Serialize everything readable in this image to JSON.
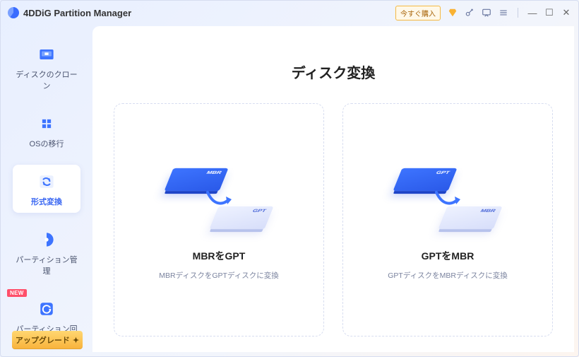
{
  "app": {
    "title": "4DDiG Partition Manager"
  },
  "titlebar": {
    "buy_label": "今すぐ購入"
  },
  "sidebar": {
    "items": [
      {
        "label": "ディスクのクローン"
      },
      {
        "label": "OSの移行"
      },
      {
        "label": "形式変換"
      },
      {
        "label": "パーティション管理"
      },
      {
        "label": "パーティション回復"
      }
    ],
    "new_badge": "NEW",
    "upgrade_label": "アップグレード"
  },
  "main": {
    "title": "ディスク変換",
    "cards": [
      {
        "from": "MBR",
        "to": "GPT",
        "title": "MBRをGPT",
        "desc": "MBRディスクをGPTディスクに変換"
      },
      {
        "from": "GPT",
        "to": "MBR",
        "title": "GPTをMBR",
        "desc": "GPTディスクをMBRディスクに変換"
      }
    ]
  }
}
